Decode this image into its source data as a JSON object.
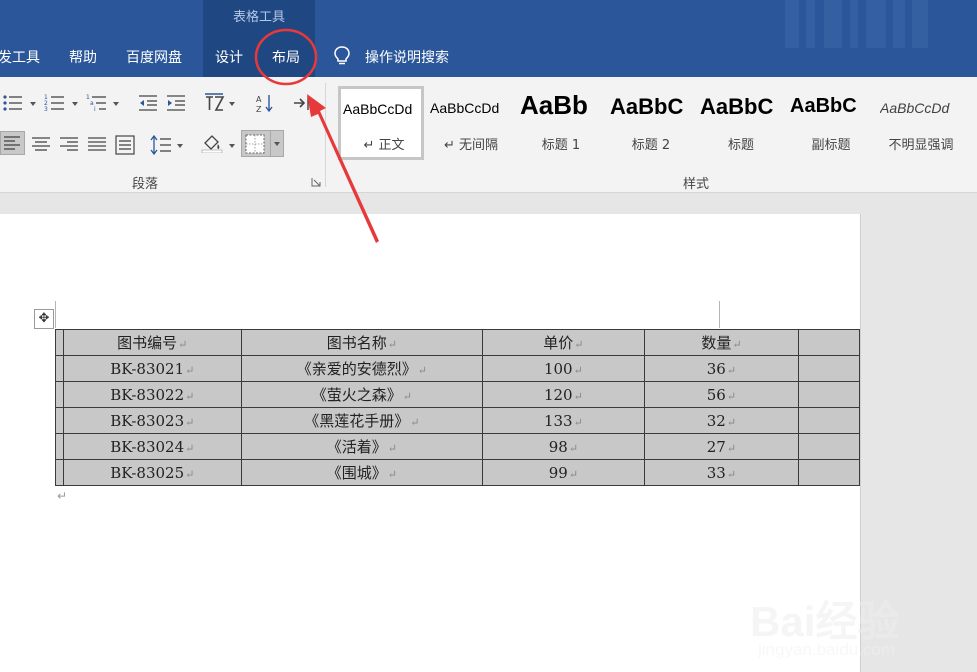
{
  "ribbon_tabs": {
    "context_group_label": "表格工具",
    "items": [
      {
        "label": "发工具"
      },
      {
        "label": "帮助"
      },
      {
        "label": "百度网盘"
      },
      {
        "label": "设计"
      },
      {
        "label": "布局"
      }
    ],
    "tell_me": "操作说明搜索"
  },
  "ribbon": {
    "paragraph_group_label": "段落",
    "styles_group_label": "样式",
    "styles": [
      {
        "sample": "AaBbCcDd",
        "name": "↵ 正文",
        "selected": true
      },
      {
        "sample": "AaBbCcDd",
        "name": "↵ 无间隔",
        "selected": false
      },
      {
        "sample": "AaBb",
        "name": "标题 1",
        "selected": false
      },
      {
        "sample": "AaBbC",
        "name": "标题 2",
        "selected": false
      },
      {
        "sample": "AaBbC",
        "name": "标题",
        "selected": false
      },
      {
        "sample": "AaBbC",
        "name": "副标题",
        "selected": false
      },
      {
        "sample": "AaBbCcDd",
        "name": "不明显强调",
        "selected": false
      }
    ]
  },
  "document": {
    "table": {
      "headers": [
        "图书编号",
        "图书名称",
        "单价",
        "数量"
      ],
      "rows": [
        [
          "BK-83021",
          "《亲爱的安德烈》",
          "100",
          "36"
        ],
        [
          "BK-83022",
          "《萤火之森》",
          "120",
          "56"
        ],
        [
          "BK-83023",
          "《黑莲花手册》",
          "133",
          "32"
        ],
        [
          "BK-83024",
          "《活着》",
          "98",
          "27"
        ],
        [
          "BK-83025",
          "《围城》",
          "99",
          "33"
        ]
      ]
    }
  },
  "annotation": {
    "color": "#e8393a"
  },
  "watermark": {
    "logo": "Bai经验",
    "sub": "jingyan.baidu.com"
  }
}
